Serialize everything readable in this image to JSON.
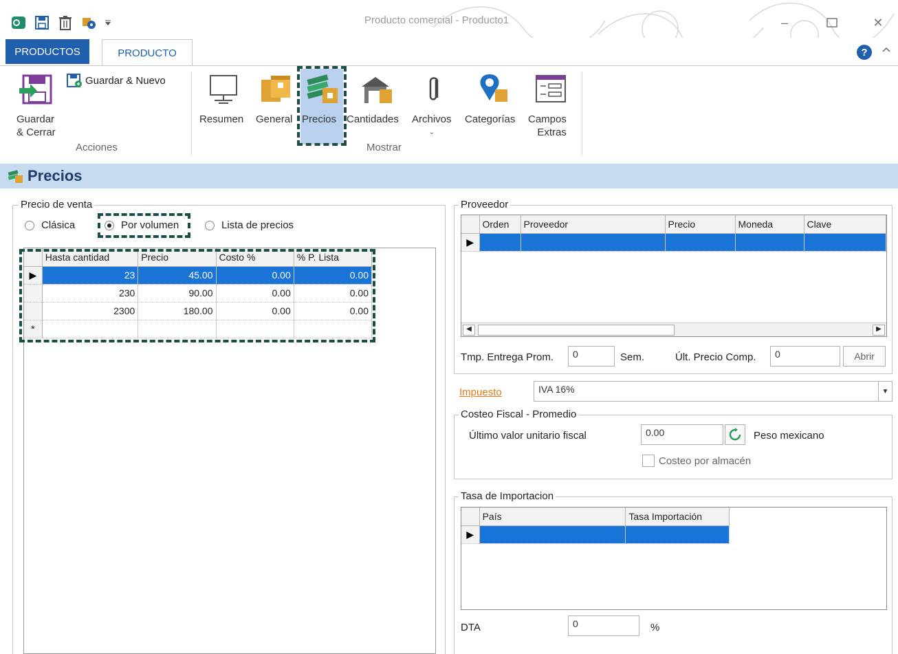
{
  "window": {
    "title": "Producto comercial - Producto1"
  },
  "tabs": {
    "productos": "PRODUCTOS",
    "producto": "PRODUCTO"
  },
  "ribbon": {
    "guardar_nuevo": "Guardar & Nuevo",
    "guardar_cerrar_1": "Guardar",
    "guardar_cerrar_2": "& Cerrar",
    "acciones": "Acciones",
    "resumen": "Resumen",
    "general": "General",
    "precios": "Precios",
    "cantidades": "Cantidades",
    "archivos": "Archivos",
    "categorias": "Categorías",
    "campos_1": "Campos",
    "campos_2": "Extras",
    "mostrar": "Mostrar"
  },
  "section": {
    "title": "Precios"
  },
  "precio_venta": {
    "legend": "Precio de venta",
    "radio_clasica": "Clásica",
    "radio_volumen": "Por volumen",
    "radio_lista": "Lista de precios",
    "columns": [
      "Hasta cantidad",
      "Precio",
      "Costo %",
      "% P. Lista"
    ],
    "rows": [
      [
        "23",
        "45.00",
        "0.00",
        "0.00"
      ],
      [
        "230",
        "90.00",
        "0.00",
        "0.00"
      ],
      [
        "2300",
        "180.00",
        "0.00",
        "0.00"
      ]
    ],
    "new_row_marker": "*"
  },
  "proveedor": {
    "legend": "Proveedor",
    "columns": [
      "Orden",
      "Proveedor",
      "Precio",
      "Moneda",
      "Clave"
    ],
    "tmp_entrega_label": "Tmp. Entrega Prom.",
    "tmp_entrega_value": "0",
    "sem_label": "Sem.",
    "ult_precio_label": "Últ. Precio Comp.",
    "ult_precio_value": "0",
    "abrir_button": "Abrir"
  },
  "impuesto": {
    "label": "Impuesto",
    "value": "IVA 16%"
  },
  "costeo_fiscal": {
    "legend": "Costeo Fiscal - Promedio",
    "ultimo_valor_label": "Último valor unitario fiscal",
    "ultimo_valor_value": "0.00",
    "moneda": "Peso mexicano",
    "costeo_almacen": "Costeo por almacén"
  },
  "tasa_importacion": {
    "legend": "Tasa de Importacion",
    "columns": [
      "País",
      "Tasa Importación"
    ],
    "dta_label": "DTA",
    "dta_value": "0",
    "dta_unit": "%"
  },
  "colors": {
    "selection": "#1a73d6",
    "accent": "#1f5fae",
    "highlight_dash": "#1b4d44",
    "section_bg": "#c6daf0"
  }
}
